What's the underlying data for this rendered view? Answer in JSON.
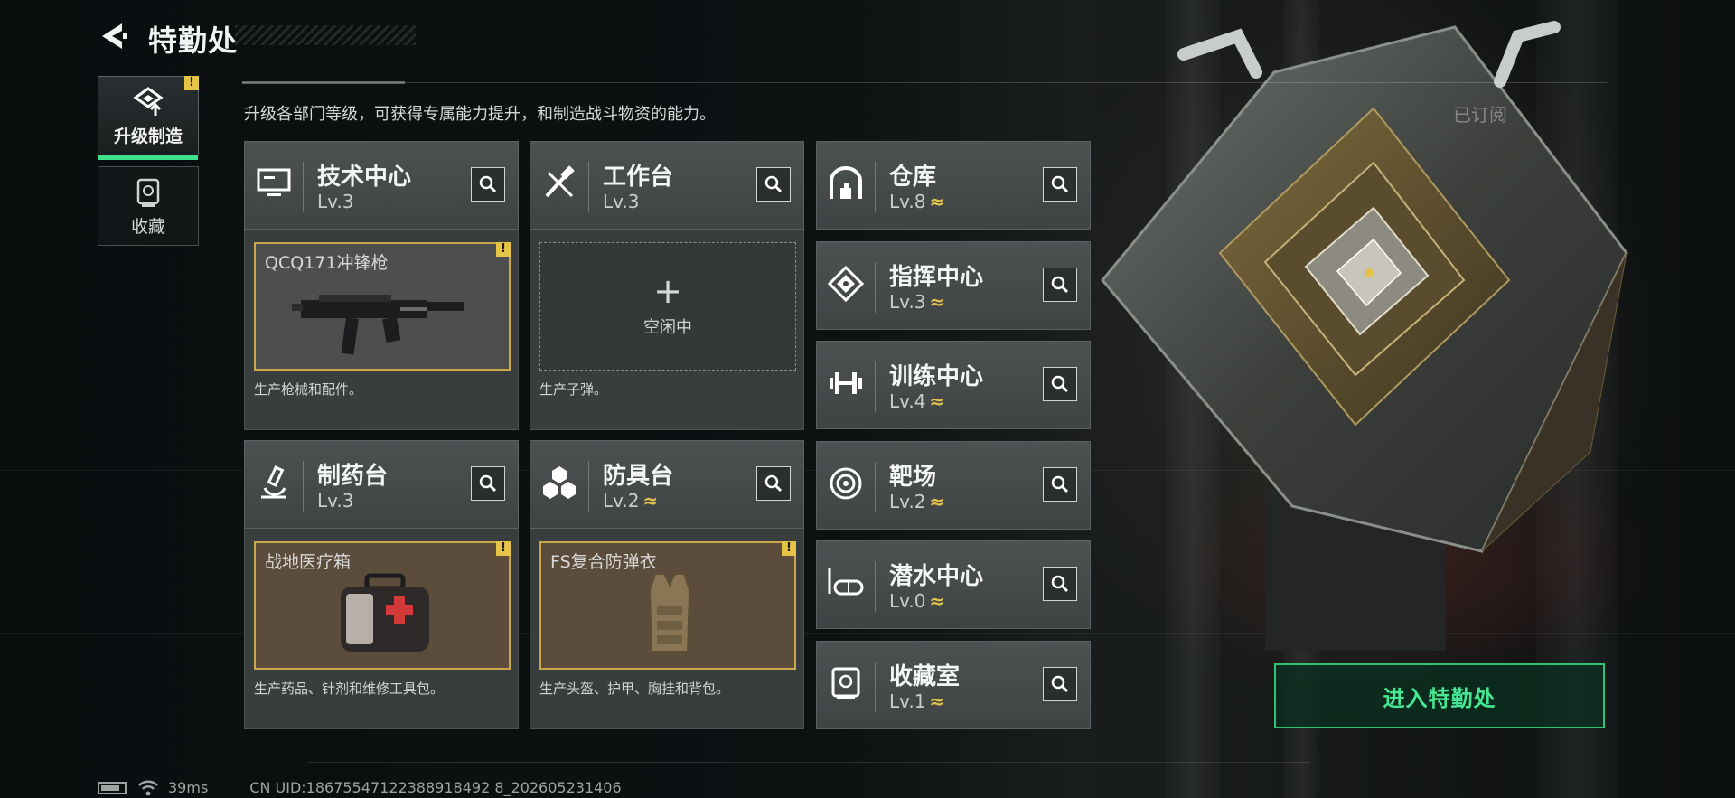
{
  "header": {
    "title": "特勤处"
  },
  "nav": [
    {
      "label": "升级制造",
      "active": true,
      "alert": "!"
    },
    {
      "label": "收藏",
      "active": false
    }
  ],
  "description": "升级各部门等级，可获得专属能力提升，和制造战斗物资的能力。",
  "facilities": [
    {
      "id": "tech-center",
      "name": "技术中心",
      "level": "Lv.3",
      "upgradable": false,
      "icon": "monitor-icon",
      "slot": {
        "state": "crafting",
        "item": "QCQ171冲锋枪",
        "alert": "!",
        "item_icon": "smg-icon"
      },
      "caption": "生产枪械和配件。"
    },
    {
      "id": "workbench",
      "name": "工作台",
      "level": "Lv.3",
      "upgradable": false,
      "icon": "tools-icon",
      "slot": {
        "state": "idle",
        "plus": "+",
        "idle_text": "空闲中"
      },
      "caption": "生产子弹。"
    },
    {
      "id": "pharmacy",
      "name": "制药台",
      "level": "Lv.3",
      "upgradable": false,
      "icon": "microscope-icon",
      "slot": {
        "state": "crafting",
        "item": "战地医疗箱",
        "alert": "!",
        "item_icon": "medkit-icon"
      },
      "caption": "生产药品、针剂和维修工具包。"
    },
    {
      "id": "armor-bench",
      "name": "防具台",
      "level": "Lv.2",
      "upgradable": true,
      "icon": "hexagons-icon",
      "slot": {
        "state": "crafting",
        "item": "FS复合防弹衣",
        "alert": "!",
        "item_icon": "vest-icon"
      },
      "caption": "生产头盔、护甲、胸挂和背包。"
    }
  ],
  "side_facilities": [
    {
      "id": "warehouse",
      "name": "仓库",
      "level": "Lv.8",
      "upgradable": true,
      "icon": "warehouse-icon"
    },
    {
      "id": "command-center",
      "name": "指挥中心",
      "level": "Lv.3",
      "upgradable": true,
      "icon": "command-icon"
    },
    {
      "id": "training-center",
      "name": "训练中心",
      "level": "Lv.4",
      "upgradable": true,
      "icon": "dumbbell-icon"
    },
    {
      "id": "shooting-range",
      "name": "靶场",
      "level": "Lv.2",
      "upgradable": true,
      "icon": "target-icon"
    },
    {
      "id": "dive-center",
      "name": "潜水中心",
      "level": "Lv.0",
      "upgradable": true,
      "icon": "goggles-icon"
    },
    {
      "id": "collection-room",
      "name": "收藏室",
      "level": "Lv.1",
      "upgradable": true,
      "icon": "trophy-icon"
    }
  ],
  "upgrade_glyph": "≈",
  "enter_button": "进入特勤处",
  "subscribed_text": "已订阅",
  "footer": {
    "ping": "39ms",
    "uid": "CN UID:18675547122388918492 8_202605231406"
  },
  "colors": {
    "accent_green": "#3ee08b",
    "alert_yellow": "#e6c445",
    "upgrade_gold": "#e4c34a"
  }
}
